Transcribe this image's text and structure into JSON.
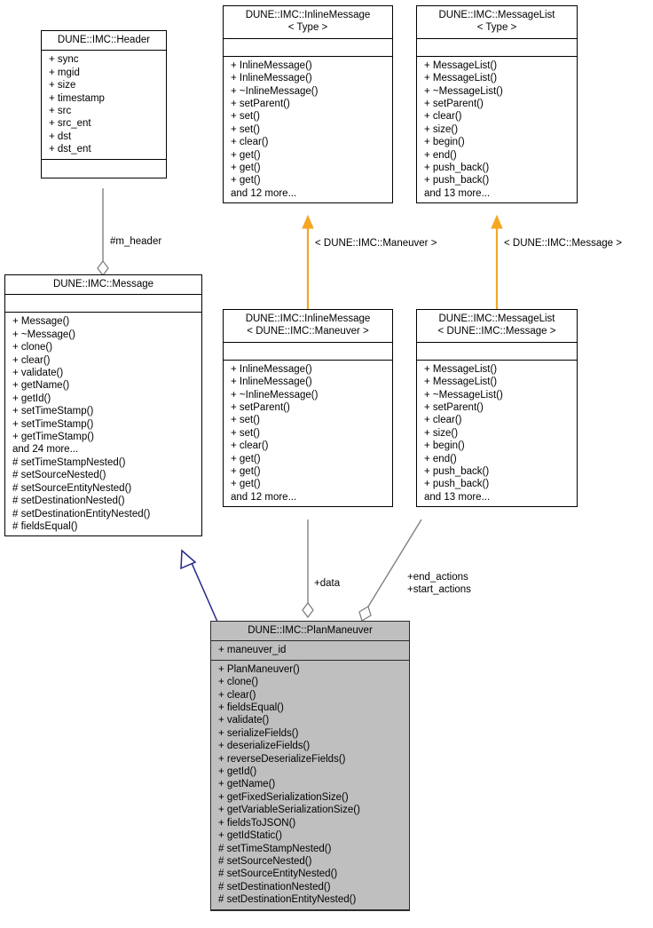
{
  "diagram": {
    "type": "uml-class-diagram",
    "title": "DUNE::IMC::PlanManeuver collaboration diagram",
    "colors": {
      "background": "#ffffff",
      "box_border": "#000000",
      "highlight_fill": "#bfbfbf",
      "inheritance_edge": "#26268c",
      "aggregation_edge": "#808080",
      "template_binding_edge": "#f5a623"
    }
  },
  "classes": [
    {
      "id": "header",
      "name": "DUNE::IMC::Header",
      "attributes": [
        "+ sync",
        "+ mgid",
        "+ size",
        "+ timestamp",
        "+ src",
        "+ src_ent",
        "+ dst",
        "+ dst_ent"
      ],
      "methods": [],
      "highlighted": false
    },
    {
      "id": "inlinemessage-type",
      "name": "DUNE::IMC::InlineMessage\n< Type >",
      "attributes": [],
      "methods": [
        "+ InlineMessage()",
        "+ InlineMessage()",
        "+ ~InlineMessage()",
        "+ setParent()",
        "+ set()",
        "+ set()",
        "+ clear()",
        "+ get()",
        "+ get()",
        "+ get()",
        "and 12 more..."
      ],
      "highlighted": false
    },
    {
      "id": "messagelist-type",
      "name": "DUNE::IMC::MessageList\n< Type >",
      "attributes": [],
      "methods": [
        "+ MessageList()",
        "+ MessageList()",
        "+ ~MessageList()",
        "+ setParent()",
        "+ clear()",
        "+ size()",
        "+ begin()",
        "+ end()",
        "+ push_back()",
        "+ push_back()",
        "and 13 more..."
      ],
      "highlighted": false
    },
    {
      "id": "message",
      "name": "DUNE::IMC::Message",
      "attributes": [],
      "methods": [
        "+ Message()",
        "+ ~Message()",
        "+ clone()",
        "+ clear()",
        "+ validate()",
        "+ getName()",
        "+ getId()",
        "+ setTimeStamp()",
        "+ setTimeStamp()",
        "+ getTimeStamp()",
        "and 24 more...",
        "# setTimeStampNested()",
        "# setSourceNested()",
        "# setSourceEntityNested()",
        "# setDestinationNested()",
        "# setDestinationEntityNested()",
        "# fieldsEqual()"
      ],
      "highlighted": false
    },
    {
      "id": "inlinemessage-maneuver",
      "name": "DUNE::IMC::InlineMessage\n< DUNE::IMC::Maneuver >",
      "attributes": [],
      "methods": [
        "+ InlineMessage()",
        "+ InlineMessage()",
        "+ ~InlineMessage()",
        "+ setParent()",
        "+ set()",
        "+ set()",
        "+ clear()",
        "+ get()",
        "+ get()",
        "+ get()",
        "and 12 more..."
      ],
      "highlighted": false
    },
    {
      "id": "messagelist-message",
      "name": "DUNE::IMC::MessageList\n< DUNE::IMC::Message >",
      "attributes": [],
      "methods": [
        "+ MessageList()",
        "+ MessageList()",
        "+ ~MessageList()",
        "+ setParent()",
        "+ clear()",
        "+ size()",
        "+ begin()",
        "+ end()",
        "+ push_back()",
        "+ push_back()",
        "and 13 more..."
      ],
      "highlighted": false
    },
    {
      "id": "planmaneuver",
      "name": "DUNE::IMC::PlanManeuver",
      "attributes": [
        "+ maneuver_id"
      ],
      "methods": [
        "+ PlanManeuver()",
        "+ clone()",
        "+ clear()",
        "+ fieldsEqual()",
        "+ validate()",
        "+ serializeFields()",
        "+ deserializeFields()",
        "+ reverseDeserializeFields()",
        "+ getId()",
        "+ getName()",
        "+ getFixedSerializationSize()",
        "+ getVariableSerializationSize()",
        "+ fieldsToJSON()",
        "+ getIdStatic()",
        "# setTimeStampNested()",
        "# setSourceNested()",
        "# setSourceEntityNested()",
        "# setDestinationNested()",
        "# setDestinationEntityNested()"
      ],
      "highlighted": true
    }
  ],
  "edges": [
    {
      "id": "header-message",
      "kind": "aggregation",
      "from": "header",
      "to": "message",
      "label": "#m_header"
    },
    {
      "id": "inlinemessage-binding",
      "kind": "template-binding",
      "from": "inlinemessage-type",
      "to": "inlinemessage-maneuver",
      "label": "< DUNE::IMC::Maneuver >"
    },
    {
      "id": "messagelist-binding",
      "kind": "template-binding",
      "from": "messagelist-type",
      "to": "messagelist-message",
      "label": "< DUNE::IMC::Message >"
    },
    {
      "id": "message-planmaneuver",
      "kind": "inheritance",
      "from": "message",
      "to": "planmaneuver",
      "label": ""
    },
    {
      "id": "data-edge",
      "kind": "aggregation",
      "from": "inlinemessage-maneuver",
      "to": "planmaneuver",
      "label": "+data"
    },
    {
      "id": "actions-edge",
      "kind": "aggregation",
      "from": "messagelist-message",
      "to": "planmaneuver",
      "label": "+end_actions\n+start_actions"
    }
  ]
}
